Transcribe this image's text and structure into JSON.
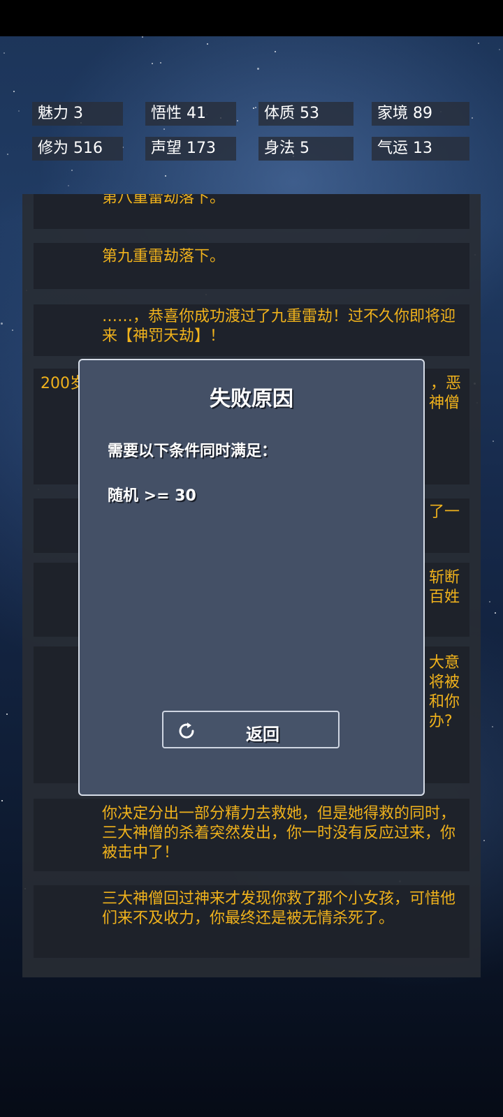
{
  "stats": [
    {
      "label": "魅力",
      "value": "3"
    },
    {
      "label": "悟性",
      "value": "41"
    },
    {
      "label": "体质",
      "value": "53"
    },
    {
      "label": "家境",
      "value": "89"
    },
    {
      "label": "修为",
      "value": "516"
    },
    {
      "label": "声望",
      "value": "173"
    },
    {
      "label": "身法",
      "value": "5"
    },
    {
      "label": "气运",
      "value": "13"
    }
  ],
  "log": {
    "entries": [
      {
        "text": "第八重雷劫落下。"
      },
      {
        "text": "第九重雷劫落下。"
      },
      {
        "text": "……，恭喜你成功渡过了九重雷劫！过不久你即将迎来【神罚天劫】！"
      },
      {
        "age": "200岁",
        "text_right_1": "，恶",
        "text_right_2": "神僧"
      },
      {
        "text_right": "了一"
      },
      {
        "text_right_1": "斩断",
        "text_right_2": "百姓"
      },
      {
        "text_right_1": "大意",
        "text_right_2": "将被",
        "text_right_3": "和你",
        "text_right_4": "办?"
      },
      {
        "text": "你决定分出一部分精力去救她，但是她得救的同时，三大神僧的杀着突然发出，你一时没有反应过来，你被击中了！"
      },
      {
        "text": "三大神僧回过神来才发现你救了那个小女孩，可惜他们来不及收力，你最终还是被无情杀死了。"
      }
    ]
  },
  "dialog": {
    "title": "失败原因",
    "condition_header": "需要以下条件同时满足：",
    "condition": "随机 >= 30",
    "back_button": "返回"
  },
  "colors": {
    "log_text": "#f0b21c",
    "dialog_bg": "#445066"
  }
}
